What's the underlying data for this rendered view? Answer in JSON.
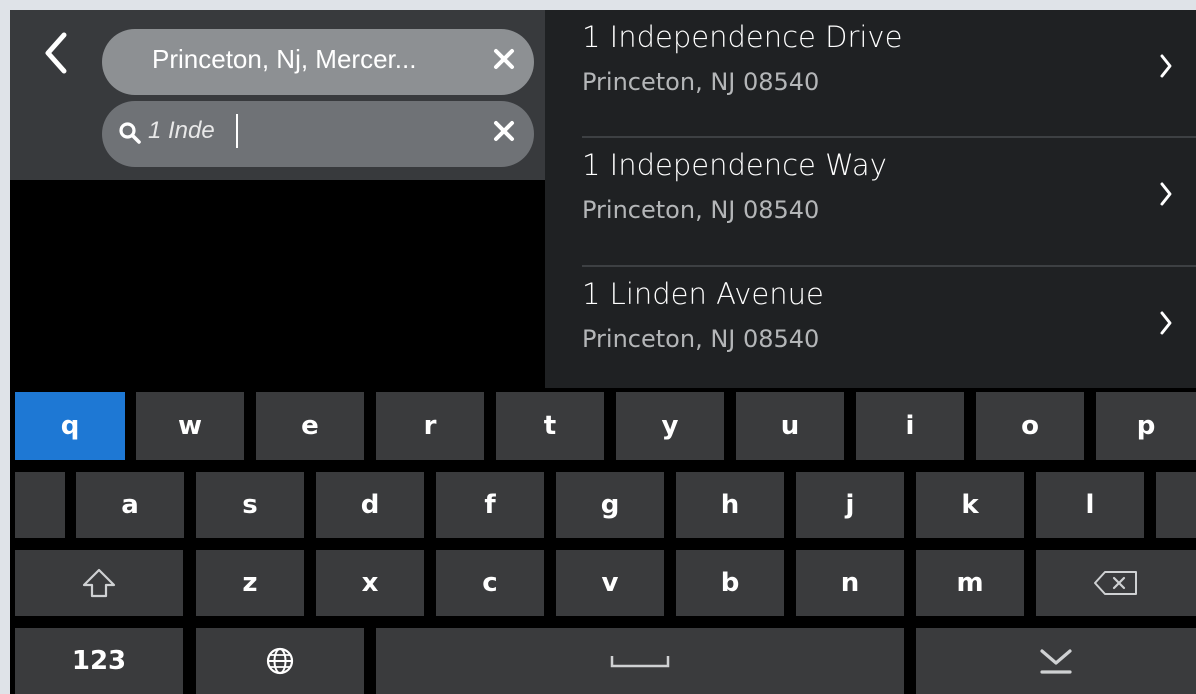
{
  "search": {
    "back_icon": "chevron-left-icon",
    "location_value": "Princeton, Nj, Mercer...",
    "query_value": "1 Inde",
    "search_icon": "search-icon",
    "clear_icon": "close-icon"
  },
  "results": [
    {
      "title": "1 Independence Drive",
      "subtitle": "Princeton, NJ 08540"
    },
    {
      "title": "1 Independence Way",
      "subtitle": "Princeton, NJ 08540"
    },
    {
      "title": "1 Linden Avenue",
      "subtitle": "Princeton, NJ 08540"
    }
  ],
  "keyboard": {
    "row1": [
      "q",
      "w",
      "e",
      "r",
      "t",
      "y",
      "u",
      "i",
      "o",
      "p"
    ],
    "row2": [
      "a",
      "s",
      "d",
      "f",
      "g",
      "h",
      "j",
      "k",
      "l"
    ],
    "row3": [
      "z",
      "x",
      "c",
      "v",
      "b",
      "n",
      "m"
    ],
    "numbers_label": "123",
    "active_key": "q",
    "icons": {
      "shift": "shift-icon",
      "backspace": "backspace-icon",
      "language": "globe-icon",
      "space": "space-bar-icon",
      "hide": "hide-keyboard-icon"
    }
  },
  "colors": {
    "accent": "#1e78d4",
    "panel": "#383a3d",
    "list_bg": "#1f2123",
    "key_bg": "#3a3b3d"
  }
}
